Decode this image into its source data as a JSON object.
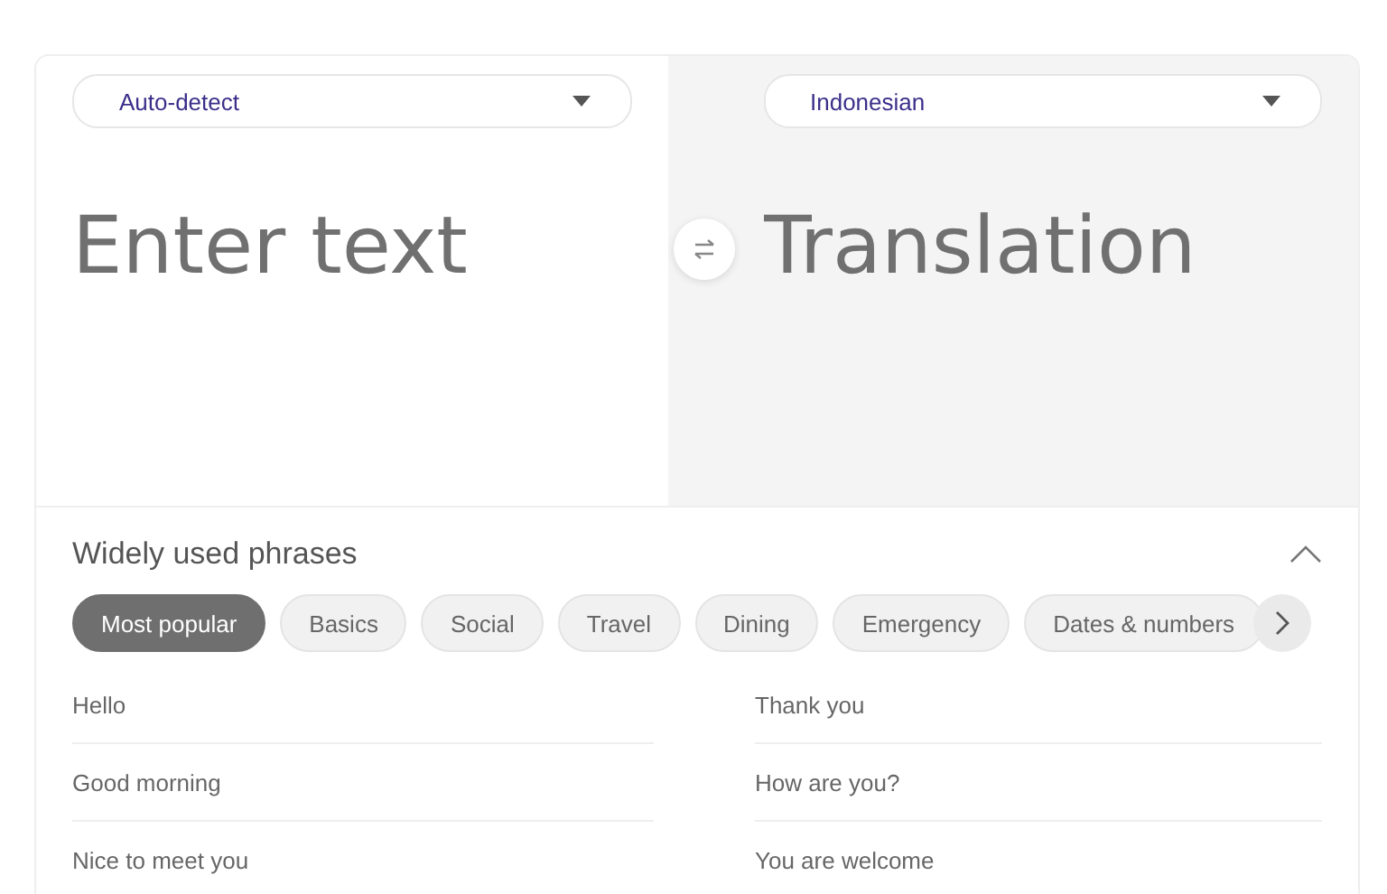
{
  "source": {
    "language": "Auto-detect",
    "placeholder": "Enter text"
  },
  "target": {
    "language": "Indonesian",
    "placeholder": "Translation"
  },
  "phrases": {
    "title": "Widely used phrases",
    "expanded": true,
    "categories": [
      {
        "label": "Most popular",
        "selected": true
      },
      {
        "label": "Basics",
        "selected": false
      },
      {
        "label": "Social",
        "selected": false
      },
      {
        "label": "Travel",
        "selected": false
      },
      {
        "label": "Dining",
        "selected": false
      },
      {
        "label": "Emergency",
        "selected": false
      },
      {
        "label": "Dates & numbers",
        "selected": false
      }
    ],
    "left": [
      "Hello",
      "Good morning",
      "Nice to meet you"
    ],
    "right": [
      "Thank you",
      "How are you?",
      "You are welcome"
    ]
  }
}
